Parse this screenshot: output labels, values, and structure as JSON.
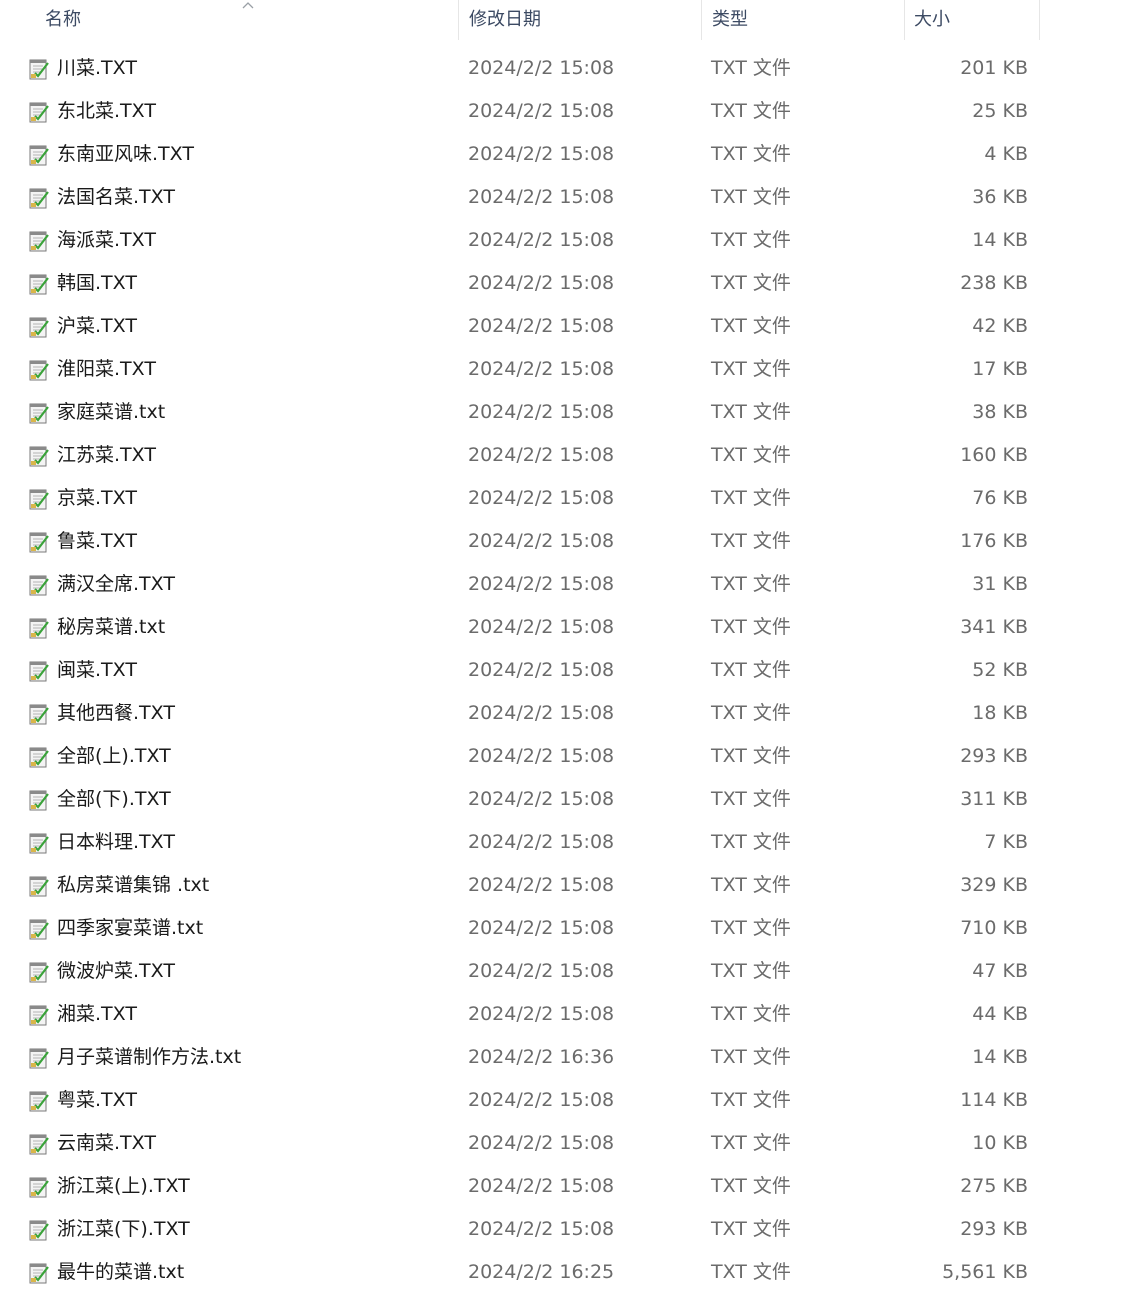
{
  "columns": {
    "name": "名称",
    "date": "修改日期",
    "type": "类型",
    "size": "大小"
  },
  "sort": {
    "column": "name",
    "direction": "ascending",
    "icon": "sort-up-icon"
  },
  "files": [
    {
      "name": "川菜.TXT",
      "date": "2024/2/2 15:08",
      "type": "TXT 文件",
      "size": "201 KB",
      "icon": "text-file-icon"
    },
    {
      "name": "东北菜.TXT",
      "date": "2024/2/2 15:08",
      "type": "TXT 文件",
      "size": "25 KB",
      "icon": "text-file-icon"
    },
    {
      "name": "东南亚风味.TXT",
      "date": "2024/2/2 15:08",
      "type": "TXT 文件",
      "size": "4 KB",
      "icon": "text-file-icon"
    },
    {
      "name": "法国名菜.TXT",
      "date": "2024/2/2 15:08",
      "type": "TXT 文件",
      "size": "36 KB",
      "icon": "text-file-icon"
    },
    {
      "name": "海派菜.TXT",
      "date": "2024/2/2 15:08",
      "type": "TXT 文件",
      "size": "14 KB",
      "icon": "text-file-icon"
    },
    {
      "name": "韩国.TXT",
      "date": "2024/2/2 15:08",
      "type": "TXT 文件",
      "size": "238 KB",
      "icon": "text-file-icon"
    },
    {
      "name": "沪菜.TXT",
      "date": "2024/2/2 15:08",
      "type": "TXT 文件",
      "size": "42 KB",
      "icon": "text-file-icon"
    },
    {
      "name": "淮阳菜.TXT",
      "date": "2024/2/2 15:08",
      "type": "TXT 文件",
      "size": "17 KB",
      "icon": "text-file-icon"
    },
    {
      "name": "家庭菜谱.txt",
      "date": "2024/2/2 15:08",
      "type": "TXT 文件",
      "size": "38 KB",
      "icon": "text-file-icon"
    },
    {
      "name": "江苏菜.TXT",
      "date": "2024/2/2 15:08",
      "type": "TXT 文件",
      "size": "160 KB",
      "icon": "text-file-icon"
    },
    {
      "name": "京菜.TXT",
      "date": "2024/2/2 15:08",
      "type": "TXT 文件",
      "size": "76 KB",
      "icon": "text-file-icon"
    },
    {
      "name": "鲁菜.TXT",
      "date": "2024/2/2 15:08",
      "type": "TXT 文件",
      "size": "176 KB",
      "icon": "text-file-icon"
    },
    {
      "name": "满汉全席.TXT",
      "date": "2024/2/2 15:08",
      "type": "TXT 文件",
      "size": "31 KB",
      "icon": "text-file-icon"
    },
    {
      "name": "秘房菜谱.txt",
      "date": "2024/2/2 15:08",
      "type": "TXT 文件",
      "size": "341 KB",
      "icon": "text-file-icon"
    },
    {
      "name": "闽菜.TXT",
      "date": "2024/2/2 15:08",
      "type": "TXT 文件",
      "size": "52 KB",
      "icon": "text-file-icon"
    },
    {
      "name": "其他西餐.TXT",
      "date": "2024/2/2 15:08",
      "type": "TXT 文件",
      "size": "18 KB",
      "icon": "text-file-icon"
    },
    {
      "name": "全部(上).TXT",
      "date": "2024/2/2 15:08",
      "type": "TXT 文件",
      "size": "293 KB",
      "icon": "text-file-icon"
    },
    {
      "name": "全部(下).TXT",
      "date": "2024/2/2 15:08",
      "type": "TXT 文件",
      "size": "311 KB",
      "icon": "text-file-icon"
    },
    {
      "name": "日本料理.TXT",
      "date": "2024/2/2 15:08",
      "type": "TXT 文件",
      "size": "7 KB",
      "icon": "text-file-icon"
    },
    {
      "name": "私房菜谱集锦 .txt",
      "date": "2024/2/2 15:08",
      "type": "TXT 文件",
      "size": "329 KB",
      "icon": "text-file-icon"
    },
    {
      "name": "四季家宴菜谱.txt",
      "date": "2024/2/2 15:08",
      "type": "TXT 文件",
      "size": "710 KB",
      "icon": "text-file-icon"
    },
    {
      "name": "微波炉菜.TXT",
      "date": "2024/2/2 15:08",
      "type": "TXT 文件",
      "size": "47 KB",
      "icon": "text-file-icon"
    },
    {
      "name": "湘菜.TXT",
      "date": "2024/2/2 15:08",
      "type": "TXT 文件",
      "size": "44 KB",
      "icon": "text-file-icon"
    },
    {
      "name": "月子菜谱制作方法.txt",
      "date": "2024/2/2 16:36",
      "type": "TXT 文件",
      "size": "14 KB",
      "icon": "text-file-icon"
    },
    {
      "name": "粤菜.TXT",
      "date": "2024/2/2 15:08",
      "type": "TXT 文件",
      "size": "114 KB",
      "icon": "text-file-icon"
    },
    {
      "name": "云南菜.TXT",
      "date": "2024/2/2 15:08",
      "type": "TXT 文件",
      "size": "10 KB",
      "icon": "text-file-icon"
    },
    {
      "name": "浙江菜(上).TXT",
      "date": "2024/2/2 15:08",
      "type": "TXT 文件",
      "size": "275 KB",
      "icon": "text-file-icon"
    },
    {
      "name": "浙江菜(下).TXT",
      "date": "2024/2/2 15:08",
      "type": "TXT 文件",
      "size": "293 KB",
      "icon": "text-file-icon"
    },
    {
      "name": "最牛的菜谱.txt",
      "date": "2024/2/2 16:25",
      "type": "TXT 文件",
      "size": "5,561 KB",
      "icon": "text-file-icon"
    }
  ]
}
